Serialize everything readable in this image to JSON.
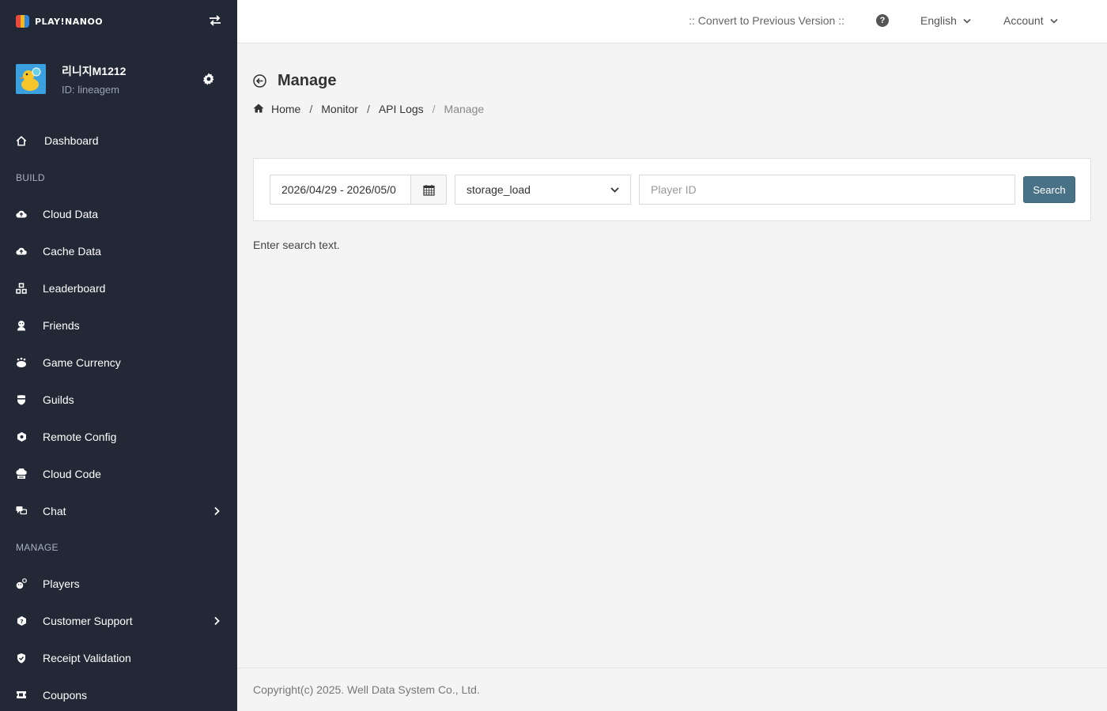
{
  "brand": {
    "name": "PLAY!NANOO"
  },
  "profile": {
    "name": "리니지M1212",
    "id_text": "ID: lineagem"
  },
  "sidebar": {
    "dashboard": "Dashboard",
    "build_label": "BUILD",
    "build_items": [
      {
        "label": "Cloud Data",
        "icon": "cloud-upload-icon"
      },
      {
        "label": "Cache Data",
        "icon": "cloud-upload-icon"
      },
      {
        "label": "Leaderboard",
        "icon": "leaderboard-icon"
      },
      {
        "label": "Friends",
        "icon": "friends-icon"
      },
      {
        "label": "Game Currency",
        "icon": "currency-icon"
      },
      {
        "label": "Guilds",
        "icon": "guild-icon"
      },
      {
        "label": "Remote Config",
        "icon": "config-icon"
      },
      {
        "label": "Cloud Code",
        "icon": "cloud-code-icon"
      },
      {
        "label": "Chat",
        "icon": "chat-icon"
      }
    ],
    "manage_label": "MANAGE",
    "manage_items": [
      {
        "label": "Players",
        "icon": "players-icon"
      },
      {
        "label": "Customer Support",
        "icon": "support-icon"
      },
      {
        "label": "Receipt Validation",
        "icon": "shield-icon"
      },
      {
        "label": "Coupons",
        "icon": "coupon-icon"
      }
    ]
  },
  "header": {
    "convert": ":: Convert to Previous Version ::",
    "help": "?",
    "language": "English",
    "account": "Account"
  },
  "page": {
    "title": "Manage",
    "breadcrumb": [
      "Home",
      "Monitor",
      "API Logs",
      "Manage"
    ],
    "separator": "/"
  },
  "search": {
    "date_range": "2026/04/29 - 2026/05/0",
    "api_select": "storage_load",
    "player_placeholder": "Player ID",
    "button": "Search"
  },
  "hint": "Enter search text.",
  "footer": "Copyright(c) 2025. Well Data System Co., Ltd."
}
